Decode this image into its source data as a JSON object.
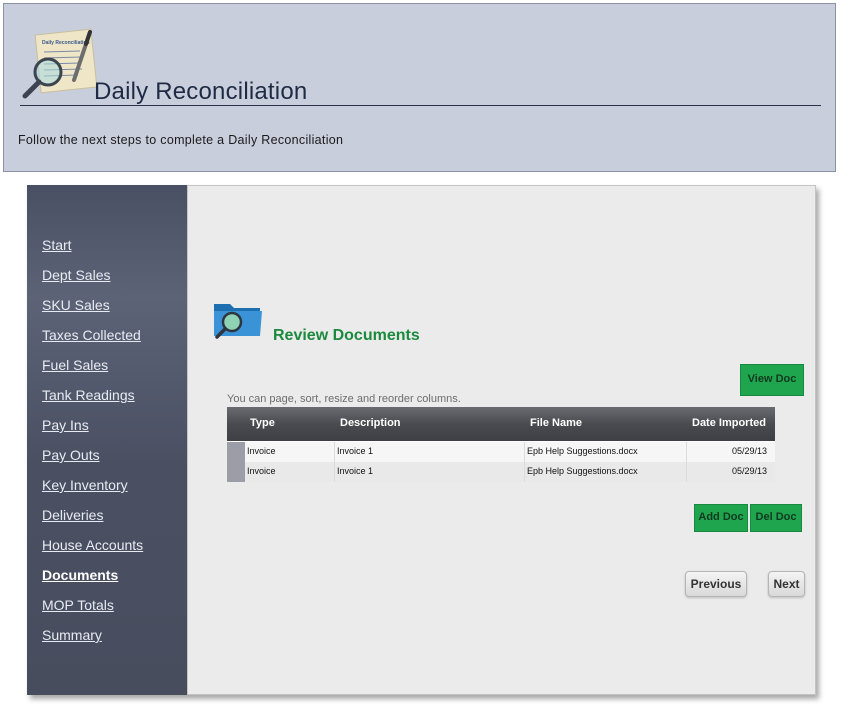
{
  "header": {
    "title": "Daily Reconciliation",
    "subtitle": "Follow the next steps to complete a Daily Reconciliation",
    "logo_text": "Daily Reconciliation"
  },
  "sidebar": {
    "items": [
      {
        "label": "Start",
        "active": false
      },
      {
        "label": "Dept Sales",
        "active": false
      },
      {
        "label": "SKU Sales",
        "active": false
      },
      {
        "label": "Taxes Collected",
        "active": false
      },
      {
        "label": "Fuel Sales",
        "active": false
      },
      {
        "label": "Tank Readings",
        "active": false
      },
      {
        "label": "Pay Ins",
        "active": false
      },
      {
        "label": "Pay Outs",
        "active": false
      },
      {
        "label": "Key Inventory",
        "active": false
      },
      {
        "label": "Deliveries",
        "active": false
      },
      {
        "label": "House Accounts",
        "active": false
      },
      {
        "label": "Documents",
        "active": true
      },
      {
        "label": "MOP Totals",
        "active": false
      },
      {
        "label": "Summary",
        "active": false
      }
    ]
  },
  "content": {
    "section_title": "Review Documents",
    "view_doc_label": "View Doc",
    "hint": "You can page, sort, resize and reorder columns.",
    "grid": {
      "columns": [
        "Type",
        "Description",
        "File Name",
        "Date Imported"
      ],
      "rows": [
        [
          "Invoice",
          "Invoice 1",
          "Epb Help Suggestions.docx",
          "05/29/13"
        ],
        [
          "Invoice",
          "Invoice 1",
          "Epb Help Suggestions.docx",
          "05/29/13"
        ]
      ]
    },
    "add_doc_label": "Add Doc",
    "del_doc_label": "Del Doc",
    "previous_label": "Previous",
    "next_label": "Next"
  },
  "colors": {
    "header_bg": "#c8cedc",
    "sidebar_bg": "#4a5063",
    "accent_green": "#1fa54e",
    "section_title": "#1c8a3e"
  },
  "icons": [
    "magnifier-document-icon",
    "folder-search-icon"
  ]
}
